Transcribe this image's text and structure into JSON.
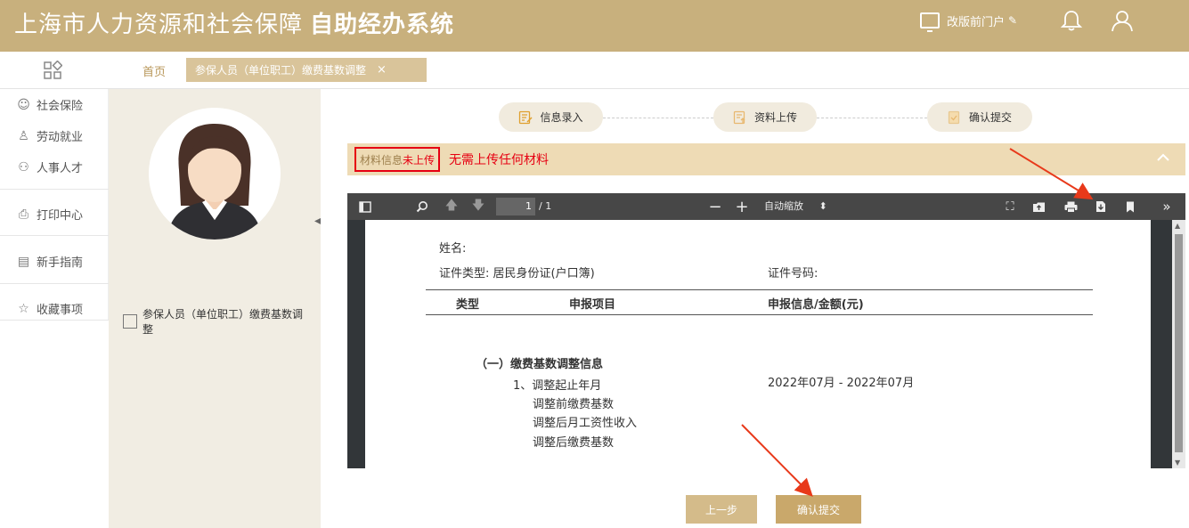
{
  "header": {
    "title_regular": "上海市人力资源和社会保障",
    "title_bold": "自助经办系统",
    "portal_link": "改版前门户",
    "icons": [
      "monitor-icon",
      "pencil-icon",
      "bell-icon",
      "user-icon"
    ]
  },
  "tabs": {
    "home": "首页",
    "active": "参保人员（单位职工）缴费基数调整",
    "close": "×"
  },
  "sidebar": {
    "items": [
      {
        "label": "社会保险",
        "icon": "social-insurance-icon"
      },
      {
        "label": "劳动就业",
        "icon": "employment-icon"
      },
      {
        "label": "人事人才",
        "icon": "talent-icon"
      },
      {
        "label": "打印中心",
        "icon": "printer-icon"
      },
      {
        "label": "新手指南",
        "icon": "guide-icon"
      },
      {
        "label": "收藏事项",
        "icon": "star-icon"
      }
    ]
  },
  "left_panel": {
    "item_label": "参保人员（单位职工）缴费基数调整"
  },
  "steps": [
    {
      "label": "信息录入"
    },
    {
      "label": "资料上传"
    },
    {
      "label": "确认提交"
    }
  ],
  "material": {
    "label": "材料信息",
    "status": "未上传",
    "message": "无需上传任何材料"
  },
  "pdf_viewer": {
    "page_current": "1",
    "page_total": "/ 1",
    "zoom": "自动缩放",
    "document": {
      "name_label": "姓名:",
      "id_type_label": "证件类型:",
      "id_type_value": "居民身份证(户口簿)",
      "id_number_label": "证件号码:",
      "col_type": "类型",
      "col_item": "申报项目",
      "col_info": "申报信息/金额(元)",
      "section_title": "（一）缴费基数调整信息",
      "row1": "1、调整起止年月",
      "row1_value": "2022年07月 - 2022年07月",
      "row2": "调整前缴费基数",
      "row3": "调整后月工资性收入",
      "row4": "调整后缴费基数"
    }
  },
  "buttons": {
    "prev": "上一步",
    "submit": "确认提交"
  },
  "colors": {
    "header_bg": "#c8b07d",
    "accent": "#c9a86b",
    "alert_red": "#e60012",
    "info_bar": "#eedbb5"
  }
}
